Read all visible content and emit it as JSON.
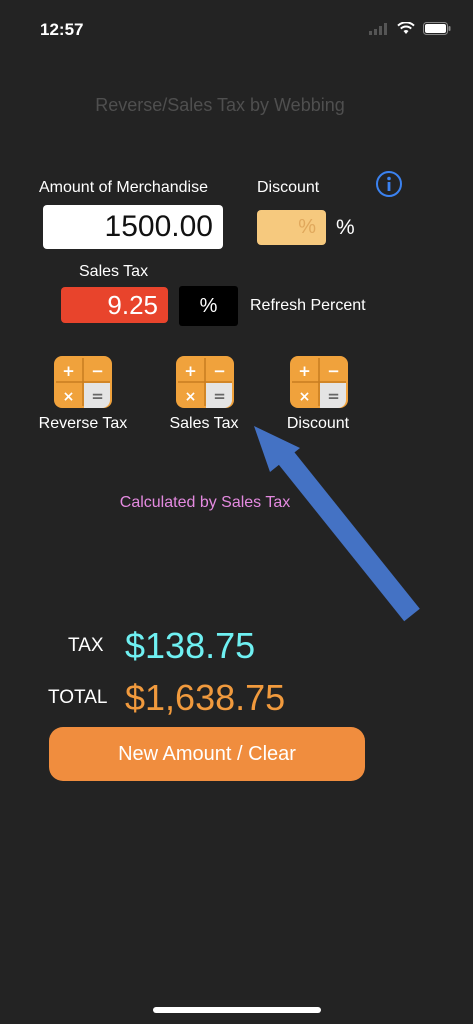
{
  "status_bar": {
    "time": "12:57"
  },
  "header": {
    "title": "Reverse/Sales Tax by Webbing"
  },
  "form": {
    "amount_label": "Amount of Merchandise",
    "amount_value": "1500.00",
    "discount_label": "Discount",
    "discount_placeholder": "%",
    "discount_unit": "%",
    "sales_tax_label": "Sales Tax",
    "sales_tax_value": "9.25",
    "percent_button": "%",
    "refresh_label": "Refresh Percent"
  },
  "calculators": [
    {
      "label": "Reverse Tax"
    },
    {
      "label": "Sales Tax"
    },
    {
      "label": "Discount"
    }
  ],
  "calc_glyphs": {
    "plus": "+",
    "minus": "−",
    "times": "×",
    "equals": "="
  },
  "calc_note": "Calculated by Sales Tax",
  "results": {
    "tax_label": "TAX",
    "tax_value": "$138.75",
    "total_label": "TOTAL",
    "total_value": "$1,638.75"
  },
  "clear_button": "New Amount / Clear",
  "colors": {
    "background": "#232323",
    "tax_value": "#6ff0f2",
    "total_value": "#f19a3d",
    "accent_orange": "#f08d3e",
    "sales_tax_field": "#e8442c",
    "note": "#e48ae0",
    "info_blue": "#3b82f0",
    "arrow_blue": "#4472c4"
  },
  "icons": [
    "signal-icon",
    "wifi-icon",
    "battery-icon",
    "info-icon",
    "calculator-icon",
    "arrow-annotation-icon"
  ]
}
